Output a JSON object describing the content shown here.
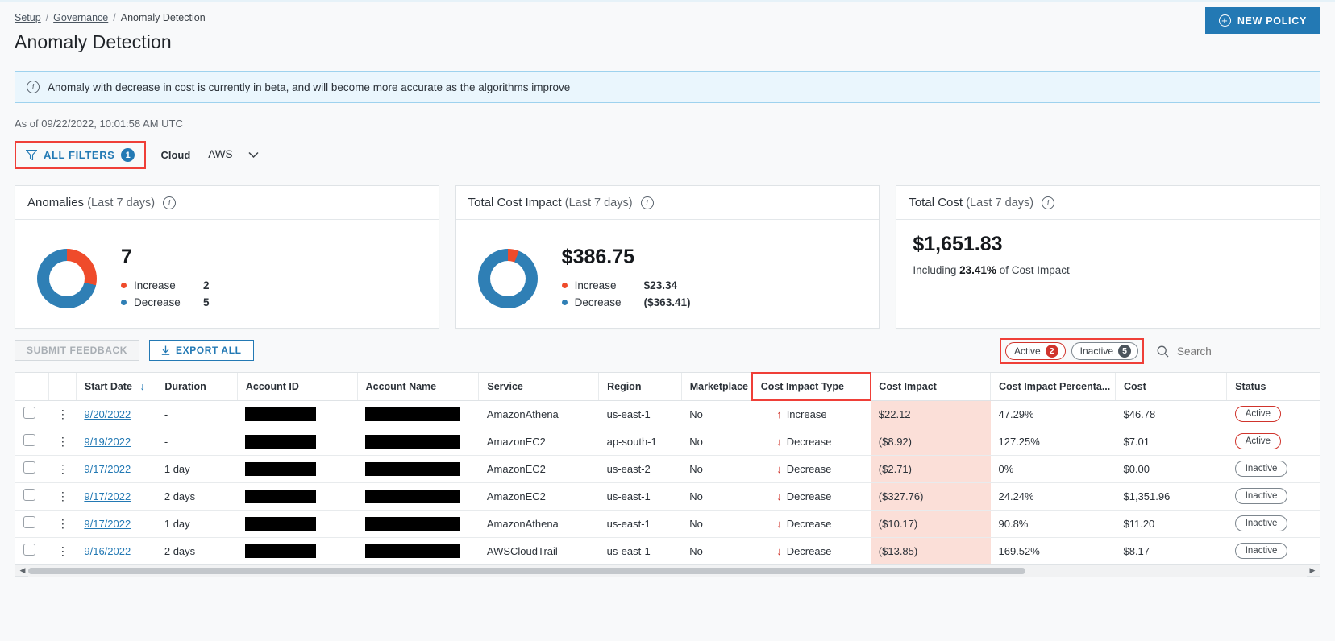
{
  "breadcrumb": {
    "item1": "Setup",
    "sep": "/",
    "item2": "Governance",
    "current": "Anomaly Detection"
  },
  "header": {
    "title": "Anomaly Detection",
    "new_policy_label": "NEW POLICY",
    "new_policy_icon": "plus-circle-icon"
  },
  "banner": {
    "icon": "info-icon",
    "text": "Anomaly with decrease in cost is currently in beta, and will become more accurate as the algorithms improve"
  },
  "asof": "As of 09/22/2022, 10:01:58 AM UTC",
  "filters": {
    "all_filters_label": "ALL FILTERS",
    "all_filters_count": "1",
    "cloud_label": "Cloud",
    "cloud_value": "AWS",
    "cloud_options": [
      "AWS"
    ]
  },
  "cards": [
    {
      "title": "Anomalies",
      "subtitle": "(Last 7 days)",
      "value": "7",
      "legend": [
        {
          "label": "Increase",
          "value": "2",
          "color": "#ef4b2b"
        },
        {
          "label": "Decrease",
          "value": "5",
          "color": "#2f7fb5"
        }
      ]
    },
    {
      "title": "Total Cost Impact",
      "subtitle": "(Last 7 days)",
      "value": "$386.75",
      "legend": [
        {
          "label": "Increase",
          "value": "$23.34",
          "color": "#ef4b2b"
        },
        {
          "label": "Decrease",
          "value": "($363.41)",
          "color": "#2f7fb5"
        }
      ]
    },
    {
      "title": "Total Cost",
      "subtitle": "(Last 7 days)",
      "value": "$1,651.83",
      "including_prefix": "Including ",
      "including_value": "23.41%",
      "including_suffix": " of Cost Impact"
    }
  ],
  "chart_data": [
    {
      "type": "pie",
      "title": "Anomalies (Last 7 days)",
      "labels": [
        "Increase",
        "Decrease"
      ],
      "values": [
        2,
        5
      ],
      "colors": [
        "#ef4b2b",
        "#2f7fb5"
      ],
      "total": 7,
      "legend_position": "right"
    },
    {
      "type": "pie",
      "title": "Total Cost Impact (Last 7 days)",
      "labels": [
        "Increase",
        "Decrease"
      ],
      "values": [
        23.34,
        363.41
      ],
      "colors": [
        "#ef4b2b",
        "#2f7fb5"
      ],
      "total": 386.75,
      "legend_position": "right"
    }
  ],
  "toolbar": {
    "submit_feedback_label": "SUBMIT FEEDBACK",
    "export_all_label": "EXPORT ALL",
    "export_icon": "download-icon",
    "active_label": "Active",
    "active_count": "2",
    "inactive_label": "Inactive",
    "inactive_count": "5",
    "search_placeholder": "Search",
    "search_value": "",
    "search_icon": "search-icon"
  },
  "table": {
    "columns": [
      "",
      "",
      "Start Date",
      "Duration",
      "Account ID",
      "Account Name",
      "Service",
      "Region",
      "Marketplace",
      "Cost Impact Type",
      "Cost Impact",
      "Cost Impact Percenta...",
      "Cost",
      "Status"
    ],
    "sort_column": "Start Date",
    "sort_direction": "desc",
    "rows": [
      {
        "start_date": "9/20/2022",
        "duration": "-",
        "account_id": "",
        "account_name": "",
        "service": "AmazonAthena",
        "region": "us-east-1",
        "marketplace": "No",
        "cost_impact_type": "Increase",
        "cost_impact": "$22.12",
        "cost_impact_pct": "47.29%",
        "cost": "$46.78",
        "status": "Active"
      },
      {
        "start_date": "9/19/2022",
        "duration": "-",
        "account_id": "",
        "account_name": "",
        "service": "AmazonEC2",
        "region": "ap-south-1",
        "marketplace": "No",
        "cost_impact_type": "Decrease",
        "cost_impact": "($8.92)",
        "cost_impact_pct": "127.25%",
        "cost": "$7.01",
        "status": "Active"
      },
      {
        "start_date": "9/17/2022",
        "duration": "1 day",
        "account_id": "",
        "account_name": "",
        "service": "AmazonEC2",
        "region": "us-east-2",
        "marketplace": "No",
        "cost_impact_type": "Decrease",
        "cost_impact": "($2.71)",
        "cost_impact_pct": "0%",
        "cost": "$0.00",
        "status": "Inactive"
      },
      {
        "start_date": "9/17/2022",
        "duration": "2 days",
        "account_id": "",
        "account_name": "",
        "service": "AmazonEC2",
        "region": "us-east-1",
        "marketplace": "No",
        "cost_impact_type": "Decrease",
        "cost_impact": "($327.76)",
        "cost_impact_pct": "24.24%",
        "cost": "$1,351.96",
        "status": "Inactive"
      },
      {
        "start_date": "9/17/2022",
        "duration": "1 day",
        "account_id": "",
        "account_name": "",
        "service": "AmazonAthena",
        "region": "us-east-1",
        "marketplace": "No",
        "cost_impact_type": "Decrease",
        "cost_impact": "($10.17)",
        "cost_impact_pct": "90.8%",
        "cost": "$11.20",
        "status": "Inactive"
      },
      {
        "start_date": "9/16/2022",
        "duration": "2 days",
        "account_id": "",
        "account_name": "",
        "service": "AWSCloudTrail",
        "region": "us-east-1",
        "marketplace": "No",
        "cost_impact_type": "Decrease",
        "cost_impact": "($13.85)",
        "cost_impact_pct": "169.52%",
        "cost": "$8.17",
        "status": "Inactive"
      }
    ]
  },
  "colors": {
    "accent_blue": "#2379b4",
    "increase_orange": "#ef4b2b",
    "decrease_blue": "#2f7fb5",
    "highlight_red": "#ef3f38",
    "active_red": "#d0342c",
    "cost_impact_bg": "#fbdfd8"
  }
}
